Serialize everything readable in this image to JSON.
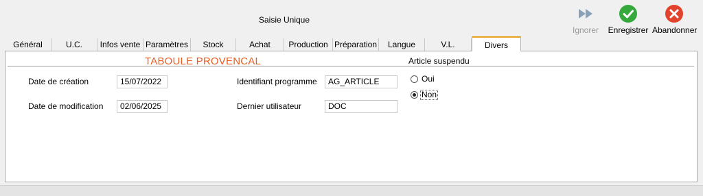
{
  "window": {
    "title": "Saisie Unique"
  },
  "toolbar": {
    "ignore_label": "Ignorer",
    "save_label": "Enregistrer",
    "abandon_label": "Abandonner"
  },
  "tabs": [
    {
      "label": "Général"
    },
    {
      "label": "U.C."
    },
    {
      "label": "Infos vente"
    },
    {
      "label": "Paramètres"
    },
    {
      "label": "Stock"
    },
    {
      "label": "Achat"
    },
    {
      "label": "Production"
    },
    {
      "label": "Préparation"
    },
    {
      "label": "Langue"
    },
    {
      "label": "V.L."
    },
    {
      "label": "Divers"
    }
  ],
  "active_tab": "Divers",
  "article": {
    "name": "TABOULE PROVENCAL"
  },
  "fields": {
    "creation_date": {
      "label": "Date de création",
      "value": "15/07/2022"
    },
    "modification_date": {
      "label": "Date de modification",
      "value": "02/06/2025"
    },
    "program_id": {
      "label": "Identifiant programme",
      "value": "AG_ARTICLE"
    },
    "last_user": {
      "label": "Dernier utilisateur",
      "value": "DOC"
    }
  },
  "suspended": {
    "label": "Article suspendu",
    "options": [
      {
        "label": "Oui",
        "selected": false
      },
      {
        "label": "Non",
        "selected": true
      }
    ]
  },
  "colors": {
    "accent_tab": "#e8a01f",
    "article_name": "#e85c1f",
    "save_green": "#35a93c",
    "abandon_red": "#e2432d",
    "ignore_disabled": "#8aa0b8"
  }
}
